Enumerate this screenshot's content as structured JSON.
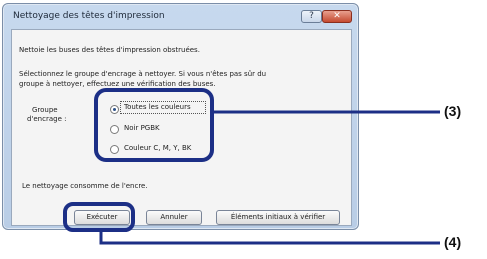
{
  "window": {
    "title": "Nettoyage des têtes d'impression",
    "help_glyph": "?",
    "close_glyph": "✕"
  },
  "body": {
    "intro": "Nettoie les buses des têtes d'impression obstruées.",
    "instruction_line1": "Sélectionnez le groupe d'encrage à nettoyer. Si vous n'êtes pas sûr du",
    "instruction_line2": "groupe à nettoyer, effectuez une vérification des buses.",
    "group_label_line1": "Groupe",
    "group_label_line2": "d'encrage :",
    "options": [
      {
        "label": "Toutes les couleurs",
        "selected": true
      },
      {
        "label": "Noir   PGBK",
        "selected": false
      },
      {
        "label": "Couleur   C, M, Y, BK",
        "selected": false
      }
    ],
    "ink_note": "Le nettoyage consomme de l'encre."
  },
  "buttons": {
    "execute": "Exécuter",
    "cancel": "Annuler",
    "check_items": "Éléments initiaux à vérifier"
  },
  "callouts": {
    "options_marker": "(3)",
    "execute_marker": "(4)"
  },
  "colors": {
    "highlight": "#1c2f86"
  }
}
